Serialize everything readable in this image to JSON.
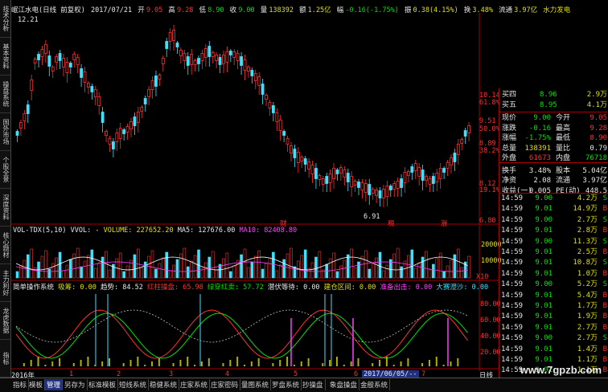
{
  "header": {
    "stock_name": "岷江水电(日线 前复权)",
    "date": "2017/07/21",
    "open_label": "开",
    "open": "9.05",
    "high_label": "高",
    "high": "9.28",
    "low_label": "低",
    "low": "8.90",
    "close_label": "收",
    "close": "9.00",
    "volume_label": "量",
    "volume": "138392",
    "amount_label": "额",
    "amount": "1.25亿",
    "change_label": "幅",
    "change": "-0.16(-1.75%)",
    "amplitude_label": "振",
    "amplitude": "0.38(4.15%)",
    "turnover_label": "换",
    "turnover": "3.48%",
    "float_label": "流通",
    "float": "3.97亿",
    "sector": "水力发电"
  },
  "price_chart": {
    "top_price": "12.21",
    "low_price": "6.91",
    "right_axis": [
      "10.14",
      "61.8%",
      "9.51",
      "50.0%",
      "8.89",
      "38.2%",
      "8.12",
      "19.1%",
      "6.80"
    ],
    "markers": [
      "财",
      "税",
      "涨"
    ]
  },
  "volume_panel": {
    "title": "VOL-TDX(5,10) VVOL: -",
    "volume_label": "VOLUME: 227652.20",
    "ma5_label": "MA5: 127676.00",
    "ma10_label": "MA10: 82408.80",
    "axis": [
      "20000",
      "10000",
      "X10"
    ]
  },
  "indicator_panel": {
    "items": [
      "简单操作系统",
      "吸筹: 0.00",
      "趋势: 84.52",
      "红柱操盘: 65.98",
      "绿穿红卖: 57.72",
      "潜伏等待: 0.00",
      "建仓区间: 0.00",
      "准备出击: 0.00",
      "大赛澄沙: 0.00"
    ],
    "axis": [
      "80.00",
      "60.00",
      "40.00",
      "20.00"
    ]
  },
  "left_tabs": [
    "技术分析",
    "基本资料",
    "操盘系统",
    "国外市场",
    "个股全景",
    "深度资料",
    "核心题材",
    "主力利好",
    "龙虎数据",
    "指标"
  ],
  "quote_panel": {
    "bid4_label": "买四",
    "bid4_price": "8.96",
    "bid4_vol": "2.9万",
    "bid5_label": "买五",
    "bid5_price": "8.95",
    "bid5_vol": "4.1万",
    "rows": [
      {
        "l1": "现价",
        "v1": "9.00",
        "l2": "今开",
        "v2": "9.05"
      },
      {
        "l1": "涨跌",
        "v1": "-0.16",
        "l2": "最高",
        "v2": "9.28"
      },
      {
        "l1": "涨幅",
        "v1": "-1.75%",
        "l2": "最低",
        "v2": "8.90"
      },
      {
        "l1": "总量",
        "v1": "138391",
        "l2": "量比",
        "v2": "0.79"
      },
      {
        "l1": "外盘",
        "v1": "61673",
        "l2": "内盘",
        "v2": "76718"
      },
      {
        "l1": "换手",
        "v1": "3.48%",
        "l2": "股本",
        "v2": "5.04亿"
      },
      {
        "l1": "净资",
        "v1": "2.08",
        "l2": "流通",
        "v2": "3.97亿"
      },
      {
        "l1": "收益(一)",
        "v1": "0.005",
        "l2": "PE(动)",
        "v2": "448.5"
      }
    ],
    "ticks": [
      {
        "time": "14:59",
        "price": "9.00",
        "vol": "4.2万",
        "side": "S"
      },
      {
        "time": "14:59",
        "price": "9.01",
        "vol": "14.9万",
        "side": "B"
      },
      {
        "time": "14:59",
        "price": "9.00",
        "vol": "2.7万",
        "side": "S"
      },
      {
        "time": "14:59",
        "price": "9.01",
        "vol": "2.8万",
        "side": "B"
      },
      {
        "time": "14:59",
        "price": "9.00",
        "vol": "11.3万",
        "side": "S"
      },
      {
        "time": "14:59",
        "price": "9.01",
        "vol": "2.5万",
        "side": "B"
      },
      {
        "time": "14:59",
        "price": "9.01",
        "vol": "10.8万",
        "side": "S"
      },
      {
        "time": "14:59",
        "price": "9.01",
        "vol": "1.0万",
        "side": "B"
      },
      {
        "time": "14:59",
        "price": "9.00",
        "vol": "5.2万",
        "side": "S"
      },
      {
        "time": "14:59",
        "price": "9.01",
        "vol": "5.4万",
        "side": "B"
      },
      {
        "time": "14:59",
        "price": "9.01",
        "vol": "1.7万",
        "side": "B"
      },
      {
        "time": "14:59",
        "price": "9.01",
        "vol": "1.9万",
        "side": "B"
      },
      {
        "time": "14:59",
        "price": "9.01",
        "vol": "2.7万",
        "side": "B"
      },
      {
        "time": "14:59",
        "price": "9.00",
        "vol": "2.7万",
        "side": "S"
      },
      {
        "time": "14:59",
        "price": "9.01",
        "vol": "1.4万",
        "side": "B"
      },
      {
        "time": "14:59",
        "price": "9.01",
        "vol": "1.1万",
        "side": "B"
      },
      {
        "time": "14:59",
        "price": "9.01",
        "vol": "1.1万",
        "side": "B"
      }
    ]
  },
  "time_axis": {
    "start": "2016年",
    "labels": [
      "1",
      "2",
      "3",
      "4",
      "5",
      "6",
      "7"
    ],
    "cursor_date": "2017/06/05/--",
    "day_label": "日线"
  },
  "bottom_tabs": [
    "指标",
    "模板",
    "管理",
    "另存为",
    "标准模板",
    "短线系统",
    "稳健系统",
    "庄家系统",
    "庄家密码",
    "量图系统",
    "罗盘系统",
    "抄操盘",
    "象盘操盘",
    "金般系统"
  ],
  "watermark": "www.7gpzb.com",
  "colors": {
    "up": "#ff3030",
    "down": "#40e0ff",
    "ma5": "#ffffff",
    "ma10": "#ff40ff",
    "bg": "#000000"
  }
}
